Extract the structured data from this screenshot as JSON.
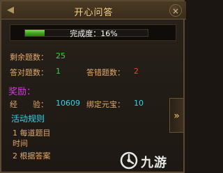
{
  "window": {
    "title": "开心问答",
    "close_label": "×",
    "nav_arrow": "◀"
  },
  "progress": {
    "label": "完成度：16%",
    "fraction": 0.16
  },
  "stats": {
    "remaining_label": "剩余题数：",
    "remaining_value": "25",
    "correct_label": "答对题数：",
    "correct_value": "1",
    "wrong_label": "答错题数：",
    "wrong_value": "2"
  },
  "rewards": {
    "heading": "奖励：",
    "exp_label": "经　　验：",
    "exp_value": "10609",
    "bound_ingot_label": "绑定元宝：",
    "bound_ingot_value": "10"
  },
  "rules": {
    "heading": "活动规则",
    "line1": "1 每道题目",
    "line2": "时间",
    "line3": "2 根据答案"
  },
  "side_button": {
    "label": "»"
  },
  "watermark": {
    "text": "九游"
  },
  "colors": {
    "title": "#f2d38a",
    "label": "#e0a86a",
    "good": "#38d638",
    "bad": "#ff3a3a",
    "value": "#2fd5e8",
    "reward_heading": "#d43ce0"
  }
}
